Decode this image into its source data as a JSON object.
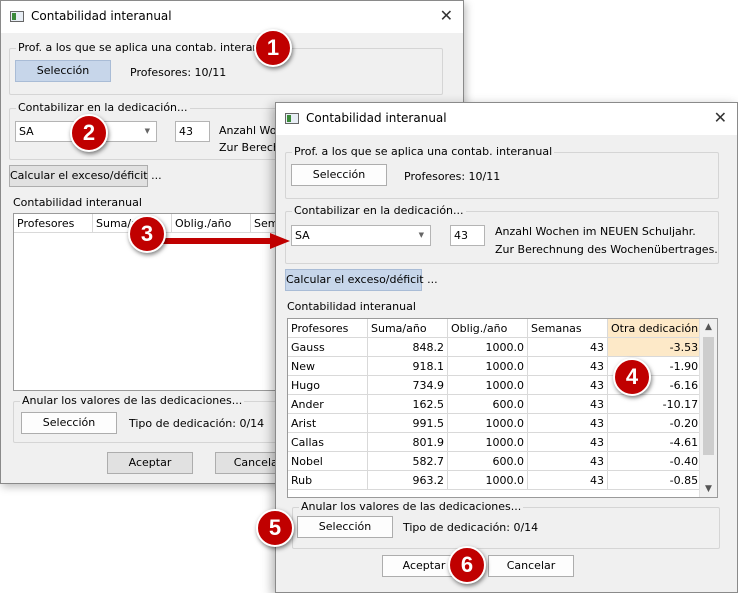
{
  "back_window": {
    "title": "Contabilidad interanual",
    "group_teachers": {
      "label": "Prof. a los que se aplica una contab. interanual",
      "button": "Selección",
      "info": "Profesores: 10/11"
    },
    "group_dedication": {
      "label": "Contabilizar en la dedicación...",
      "combo_value": "SA",
      "weeks": "43",
      "note1": "Anzahl Woc",
      "note2": "Zur Berechn"
    },
    "calc_button": "Calcular el exceso/déficit ...",
    "list_label": "Contabilidad interanual",
    "columns": [
      "Profesores",
      "Suma/año",
      "Oblig./año",
      "Sem"
    ],
    "group_reset": {
      "label": "Anular los valores de las dedicaciones...",
      "button": "Selección",
      "info": "Tipo de dedicación: 0/14"
    },
    "ok": "Aceptar",
    "cancel": "Cancelar"
  },
  "front_window": {
    "title": "Contabilidad interanual",
    "group_teachers": {
      "label": "Prof. a los que se aplica una contab. interanual",
      "button": "Selección",
      "info": "Profesores: 10/11"
    },
    "group_dedication": {
      "label": "Contabilizar en la dedicación...",
      "combo_value": "SA",
      "weeks": "43",
      "note1": "Anzahl Wochen im NEUEN Schuljahr.",
      "note2": "Zur Berechnung des Wochenübertrages."
    },
    "calc_button": "Calcular el exceso/déficit ...",
    "list_label": "Contabilidad interanual",
    "columns": [
      "Profesores",
      "Suma/año",
      "Oblig./año",
      "Semanas",
      "Otra dedicación"
    ],
    "rows": [
      [
        "Gauss",
        "848.2",
        "1000.0",
        "43",
        "-3.53"
      ],
      [
        "New",
        "918.1",
        "1000.0",
        "43",
        "-1.90"
      ],
      [
        "Hugo",
        "734.9",
        "1000.0",
        "43",
        "-6.16"
      ],
      [
        "Ander",
        "162.5",
        "600.0",
        "43",
        "-10.17"
      ],
      [
        "Arist",
        "991.5",
        "1000.0",
        "43",
        "-0.20"
      ],
      [
        "Callas",
        "801.9",
        "1000.0",
        "43",
        "-4.61"
      ],
      [
        "Nobel",
        "582.7",
        "600.0",
        "43",
        "-0.40"
      ],
      [
        "Rub",
        "963.2",
        "1000.0",
        "43",
        "-0.85"
      ]
    ],
    "group_reset": {
      "label": "Anular los valores de las dedicaciones...",
      "button": "Selección",
      "info": "Tipo de dedicación: 0/14"
    },
    "ok": "Aceptar",
    "cancel": "Cancelar"
  },
  "markers": [
    "1",
    "2",
    "3",
    "4",
    "5",
    "6"
  ],
  "colors": {
    "marker": "#c00000",
    "highlight": "#fde9c8",
    "button_blue": "#c7d6ea"
  }
}
